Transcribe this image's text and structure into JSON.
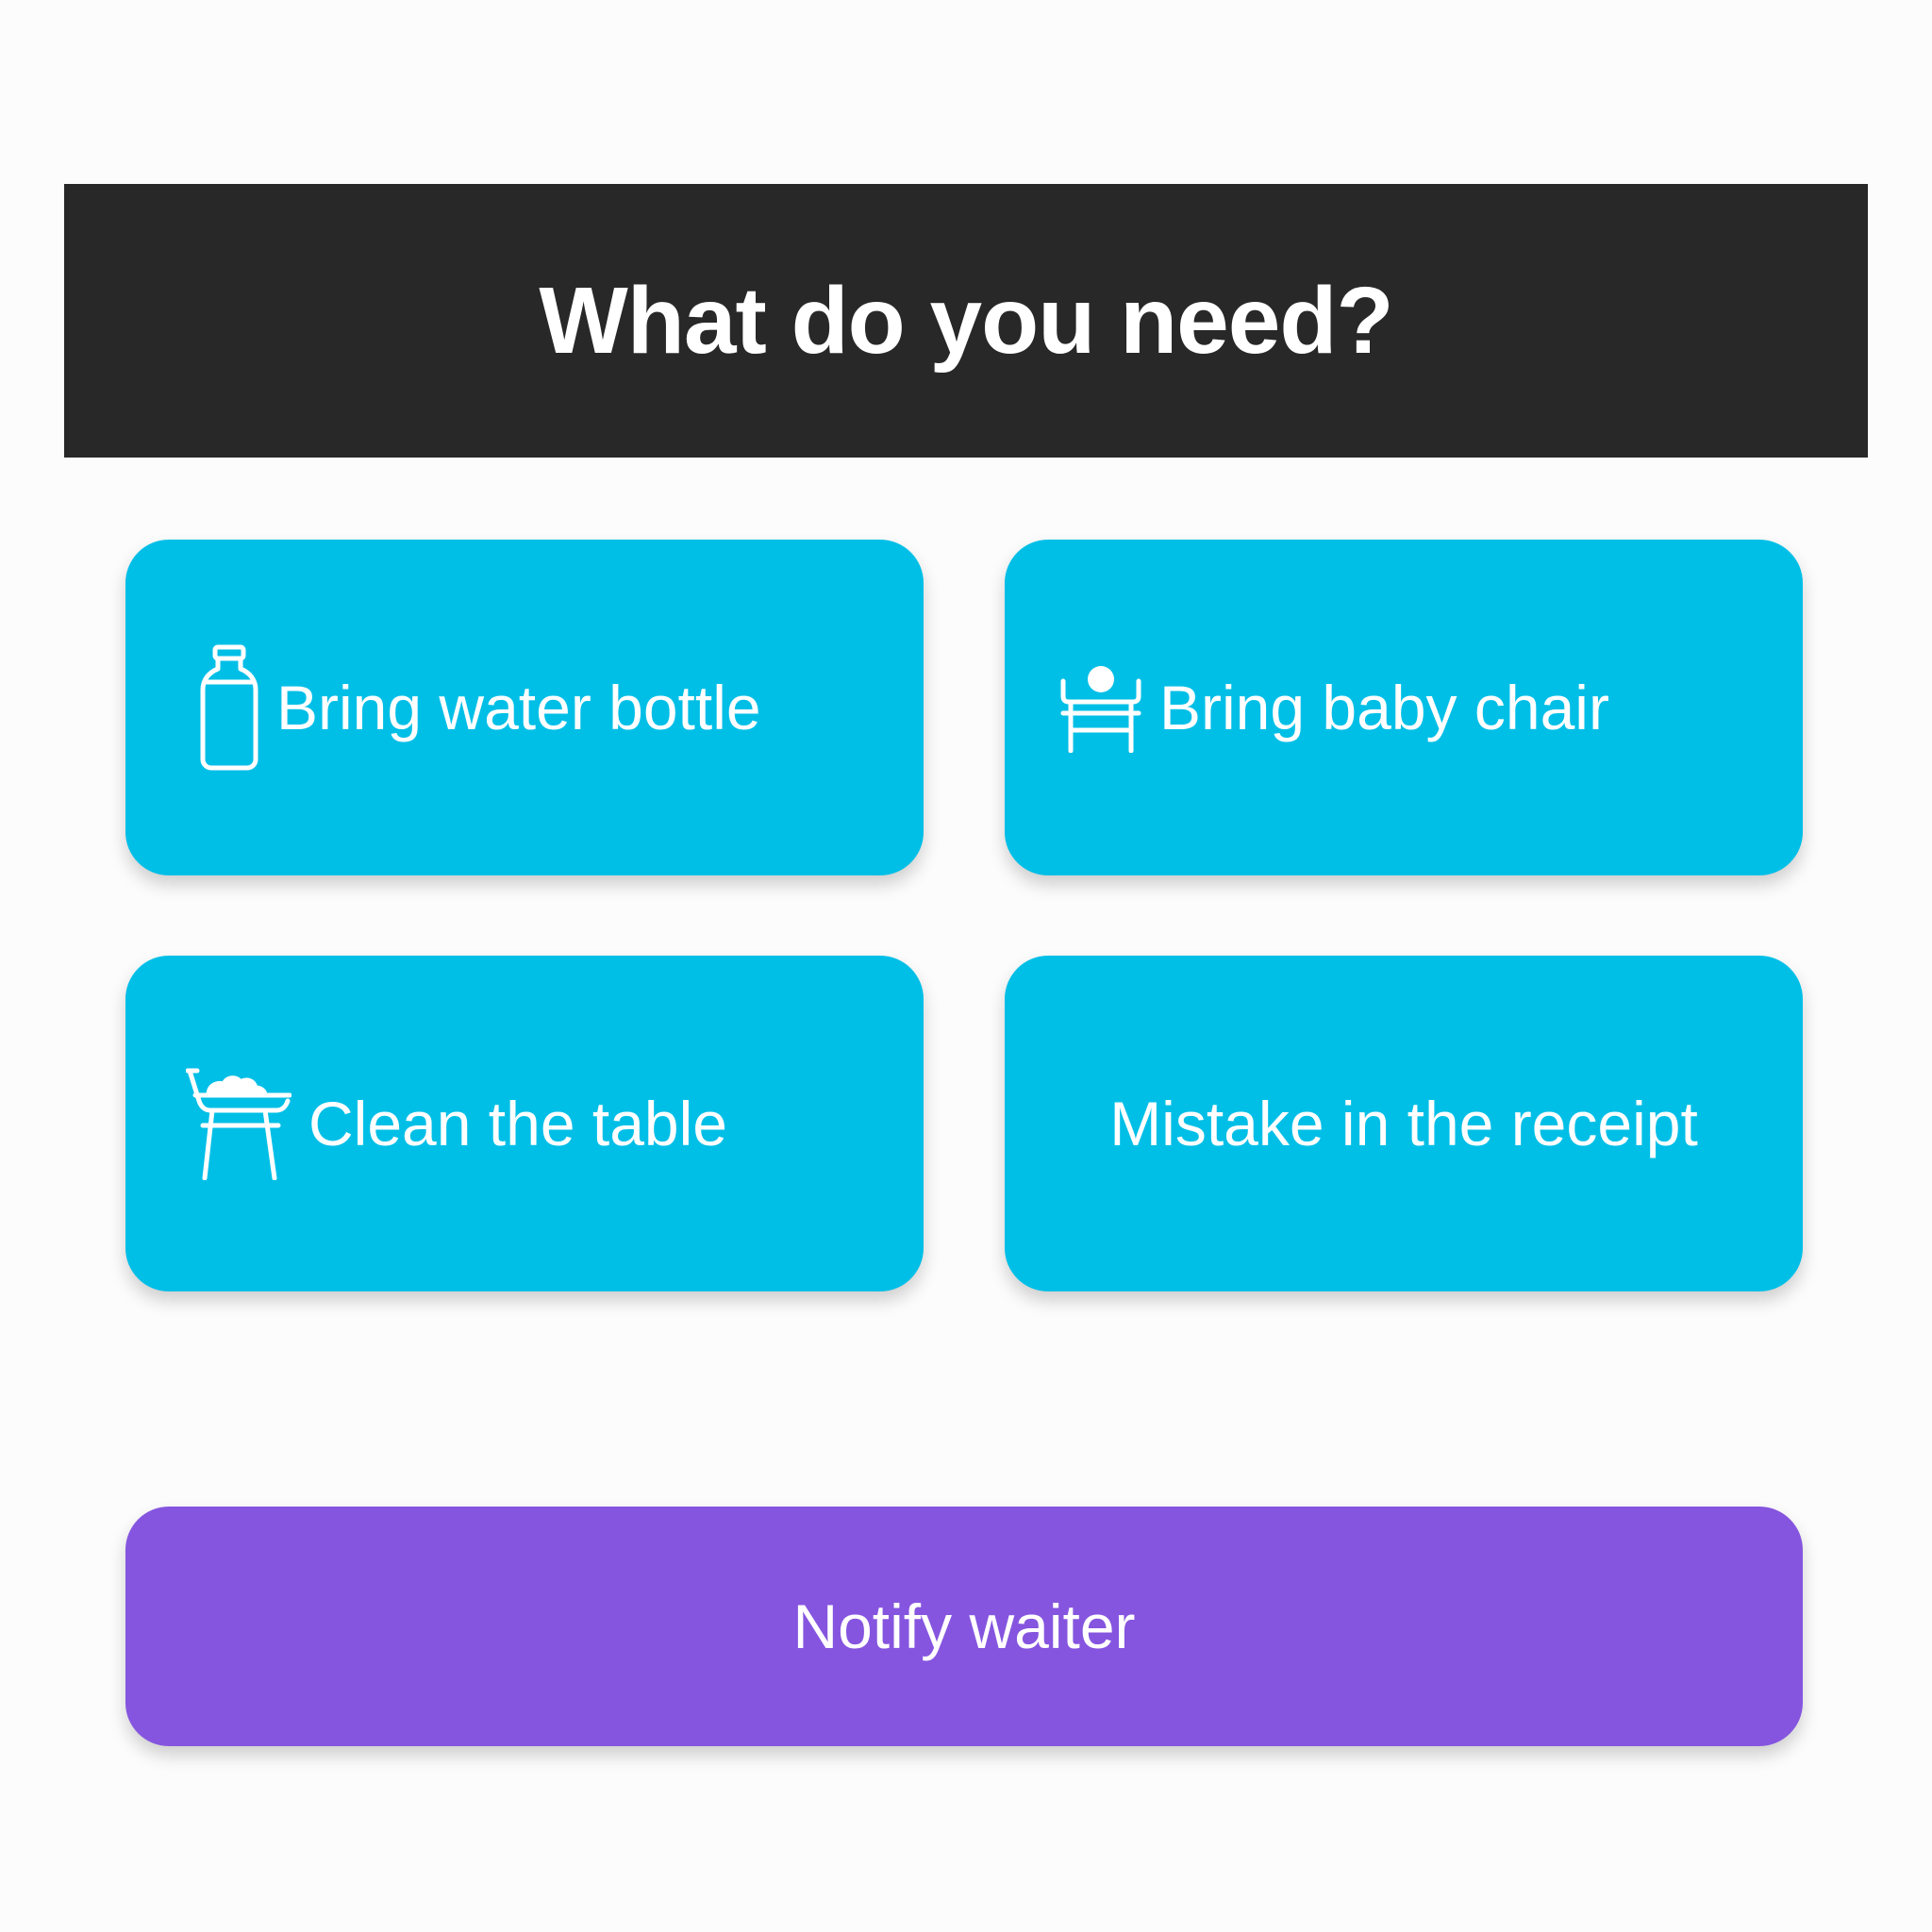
{
  "header": {
    "title": "What do you need?"
  },
  "options": [
    {
      "label": "Bring water bottle",
      "icon": "bottle-icon"
    },
    {
      "label": "Bring baby chair",
      "icon": "baby-chair-icon"
    },
    {
      "label": "Clean the table",
      "icon": "table-icon"
    },
    {
      "label": "Mistake in the receipt",
      "icon": ""
    }
  ],
  "notify": {
    "label": "Notify waiter"
  },
  "colors": {
    "header_bg": "#282828",
    "option_bg": "#00bfe7",
    "notify_bg": "#8555df",
    "page_bg": "#fcfcfc",
    "text": "#ffffff"
  }
}
